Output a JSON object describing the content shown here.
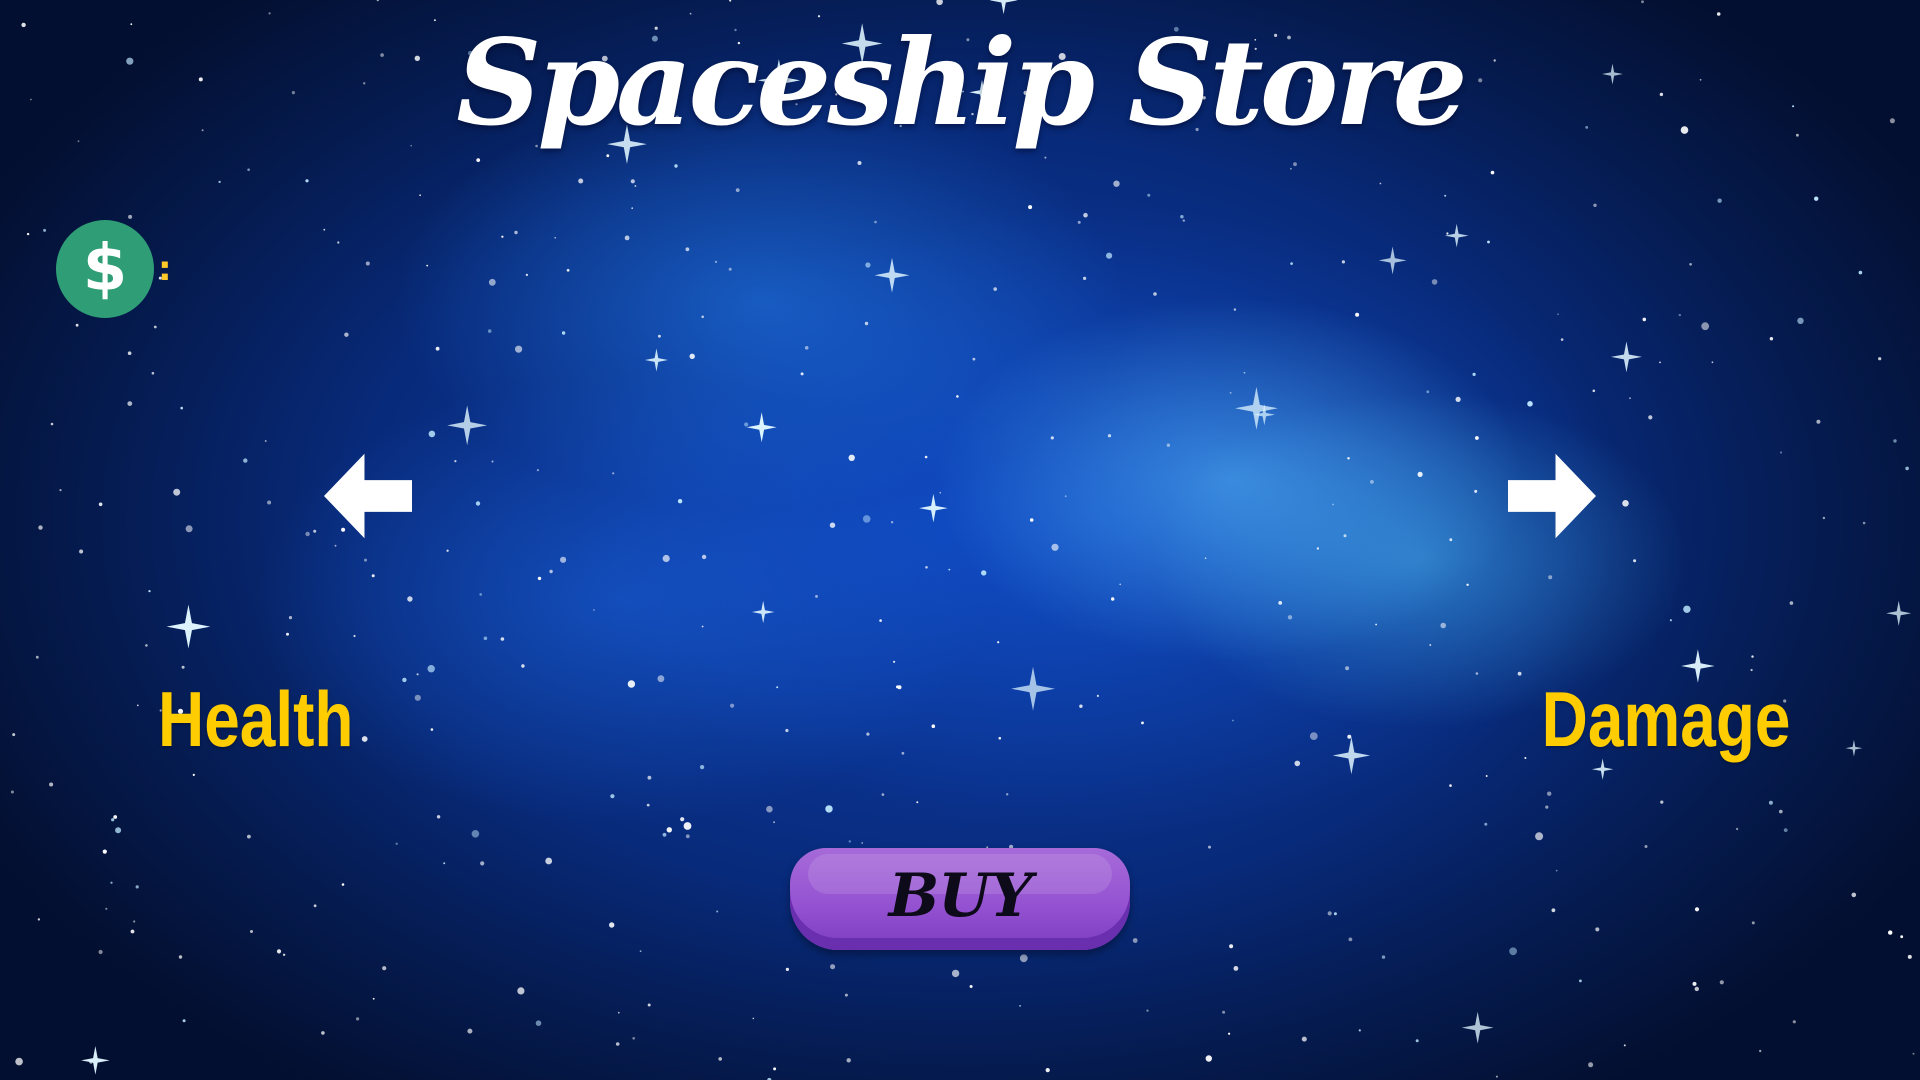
{
  "store": {
    "title": "Spaceship Store"
  },
  "currency": {
    "icon": "dollar-coin-icon",
    "symbol": "$",
    "separator": ":",
    "amount": "",
    "coin_color": "#2f9e76",
    "text_color": "#ffc928"
  },
  "navigation": {
    "prev_icon": "arrow-left-icon",
    "next_icon": "arrow-right-icon"
  },
  "stats": {
    "left_label": "Health",
    "right_label": "Damage",
    "label_color": "#ffcc00"
  },
  "actions": {
    "buy_label": "BUY",
    "buy_color": "#9553d2"
  }
}
